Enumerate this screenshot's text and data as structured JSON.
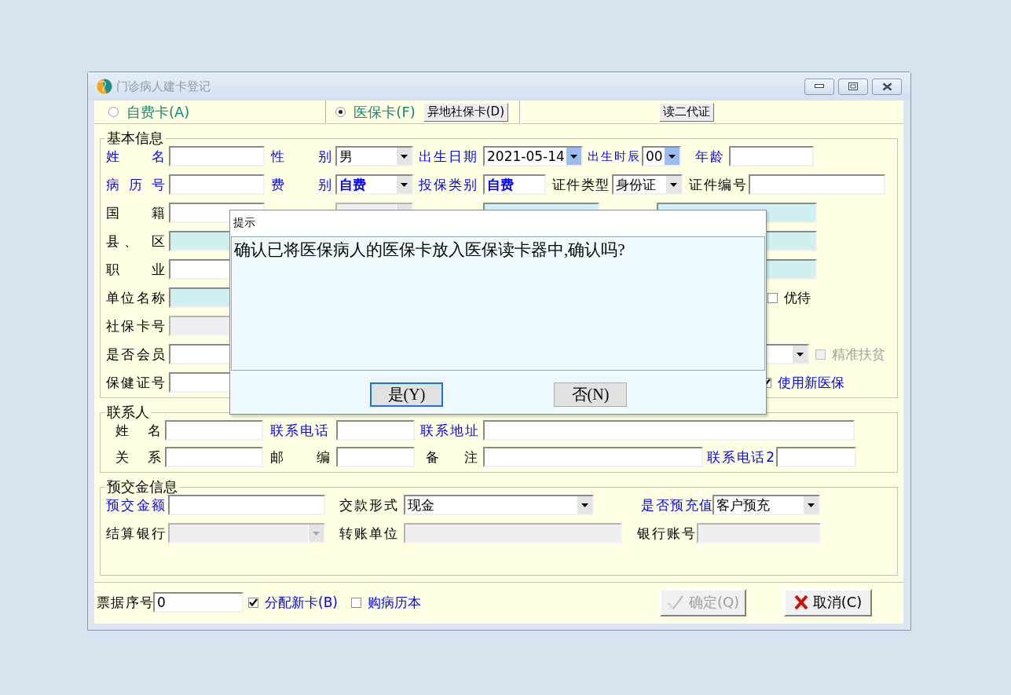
{
  "window": {
    "title": "门诊病人建卡登记"
  },
  "card_type": {
    "options": [
      {
        "label": "自费卡(A)",
        "selected": false
      },
      {
        "label": "医保卡(F)",
        "selected": true
      }
    ],
    "other_region_button": "异地社保卡(D)",
    "read_id_button": "读二代证"
  },
  "basic_info": {
    "title": "基本信息",
    "rows": [
      {
        "items": [
          {
            "kind": "label",
            "text": "姓 名",
            "required": true
          },
          {
            "kind": "field",
            "highlighted": false,
            "disabled": false
          },
          {
            "kind": "label",
            "text": "性 别",
            "required": true
          },
          {
            "kind": "select",
            "value": "男",
            "highlighted": false,
            "disabled": false
          },
          {
            "kind": "label",
            "text": "出生日期",
            "required": true
          },
          {
            "kind": "select",
            "value": "2021-05-14",
            "highlighted": true,
            "disabled": false
          },
          {
            "kind": "label",
            "text": "出生时辰",
            "required": true
          },
          {
            "kind": "select",
            "value": "00",
            "highlighted": true,
            "disabled": false
          },
          {
            "kind": "label",
            "text": "年龄",
            "required": true
          },
          {
            "kind": "field",
            "highlighted": false,
            "disabled": false
          }
        ]
      },
      {
        "items": [
          {
            "kind": "label",
            "text": "病 历 号",
            "required": true
          },
          {
            "kind": "field",
            "highlighted": false,
            "disabled": false
          },
          {
            "kind": "label",
            "text": "费 别",
            "required": true
          },
          {
            "kind": "select",
            "value": "自费",
            "emphasis": true,
            "highlighted": false,
            "disabled": false
          },
          {
            "kind": "label",
            "text": "投保类别",
            "required": true
          },
          {
            "kind": "field",
            "value": "自费",
            "emphasis": true,
            "highlighted": false,
            "disabled": false
          },
          {
            "kind": "label",
            "text": "证件类型",
            "required": false
          },
          {
            "kind": "select",
            "value": "身份证",
            "highlighted": false,
            "disabled": false
          },
          {
            "kind": "label",
            "text": "证件编号",
            "required": false
          },
          {
            "kind": "field",
            "highlighted": false,
            "disabled": false
          }
        ]
      },
      {
        "items": [
          {
            "kind": "label",
            "text": "国 籍",
            "required": false
          },
          {
            "kind": "field",
            "highlighted": false,
            "disabled": false
          },
          {
            "kind": "select",
            "highlighted": false,
            "disabled": true
          },
          {
            "kind": "field",
            "highlighted": true,
            "disabled": false
          },
          {
            "kind": "field",
            "highlighted": true,
            "disabled": false
          }
        ]
      },
      {
        "items": [
          {
            "kind": "label",
            "text": "县、 区",
            "required": false
          },
          {
            "kind": "field",
            "highlighted": true,
            "disabled": false
          },
          {
            "kind": "field",
            "highlighted": true,
            "disabled": false
          }
        ]
      },
      {
        "items": [
          {
            "kind": "label",
            "text": "职 业",
            "required": false
          },
          {
            "kind": "field",
            "highlighted": false,
            "disabled": false
          },
          {
            "kind": "field",
            "highlighted": true,
            "disabled": false
          }
        ]
      },
      {
        "items": [
          {
            "kind": "label",
            "text": "单位名称",
            "required": false
          },
          {
            "kind": "field",
            "highlighted": true,
            "disabled": false
          },
          {
            "kind": "check",
            "label": "优待",
            "checked": false,
            "disabled": false,
            "required": false
          }
        ]
      },
      {
        "items": [
          {
            "kind": "label",
            "text": "社保卡号",
            "required": false
          },
          {
            "kind": "field",
            "highlighted": false,
            "disabled": true
          }
        ]
      },
      {
        "items": [
          {
            "kind": "label",
            "text": "是否会员",
            "required": false
          },
          {
            "kind": "field",
            "highlighted": false,
            "disabled": false
          },
          {
            "kind": "select",
            "highlighted": false,
            "disabled": false
          },
          {
            "kind": "check",
            "label": "精准扶贫",
            "checked": false,
            "disabled": true,
            "required": false
          }
        ]
      },
      {
        "items": [
          {
            "kind": "label",
            "text": "保健证号",
            "required": false
          },
          {
            "kind": "field",
            "highlighted": false,
            "disabled": false
          },
          {
            "kind": "check",
            "label": "使用新医保",
            "checked": true,
            "disabled": false,
            "required": true
          }
        ]
      }
    ]
  },
  "contact": {
    "title": "联系人",
    "rows": [
      {
        "items": [
          {
            "kind": "label",
            "text": "姓 名",
            "required": false
          },
          {
            "kind": "field",
            "highlighted": false,
            "disabled": false
          },
          {
            "kind": "label",
            "text": "联系电话",
            "required": true
          },
          {
            "kind": "field",
            "highlighted": false,
            "disabled": false
          },
          {
            "kind": "label",
            "text": "联系地址",
            "required": true
          },
          {
            "kind": "field",
            "highlighted": false,
            "disabled": false
          }
        ]
      },
      {
        "items": [
          {
            "kind": "label",
            "text": "关 系",
            "required": false
          },
          {
            "kind": "field",
            "highlighted": false,
            "disabled": false
          },
          {
            "kind": "label",
            "text": "邮 编",
            "required": false
          },
          {
            "kind": "field",
            "highlighted": false,
            "disabled": false
          },
          {
            "kind": "label",
            "text": "备 注",
            "required": false
          },
          {
            "kind": "field",
            "highlighted": false,
            "disabled": false
          },
          {
            "kind": "label",
            "text": "联系电话2",
            "required": true
          },
          {
            "kind": "field",
            "highlighted": false,
            "disabled": false
          }
        ]
      }
    ]
  },
  "prepayment": {
    "title": "预交金信息",
    "rows": [
      {
        "items": [
          {
            "kind": "label",
            "text": "预交金额",
            "required": true
          },
          {
            "kind": "field",
            "highlighted": false,
            "disabled": false
          },
          {
            "kind": "label",
            "text": "交款形式",
            "required": false
          },
          {
            "kind": "select",
            "value": "现金",
            "highlighted": false,
            "disabled": false
          },
          {
            "kind": "label",
            "text": "是否预充值",
            "required": true
          },
          {
            "kind": "select",
            "value": "客户预充",
            "highlighted": false,
            "disabled": false
          }
        ]
      },
      {
        "items": [
          {
            "kind": "label",
            "text": "结算银行",
            "required": false
          },
          {
            "kind": "select",
            "highlighted": false,
            "disabled": true
          },
          {
            "kind": "label",
            "text": "转账单位",
            "required": false
          },
          {
            "kind": "field",
            "highlighted": false,
            "disabled": true
          },
          {
            "kind": "label",
            "text": "银行账号",
            "required": false
          },
          {
            "kind": "field",
            "highlighted": false,
            "disabled": true
          }
        ]
      }
    ]
  },
  "footer": {
    "items": [
      {
        "kind": "label",
        "text": "票据序号",
        "required": false
      },
      {
        "kind": "field",
        "value": "0",
        "highlighted": false,
        "disabled": false
      },
      {
        "kind": "check",
        "label": "分配新卡(B)",
        "checked": true,
        "disabled": false,
        "required": true
      },
      {
        "kind": "check",
        "label": "购病历本",
        "checked": false,
        "disabled": false,
        "required": true
      },
      {
        "kind": "confirm",
        "label": "确定(Q)",
        "disabled": true
      },
      {
        "kind": "cancel",
        "label": "取消(C)",
        "disabled": false
      }
    ]
  },
  "dialog": {
    "title": "提示",
    "message": "确认已将医保病人的医保卡放入医保读卡器中,确认吗?",
    "buttons": [
      {
        "label": "是(Y)",
        "focused": true
      },
      {
        "label": "否(N)",
        "focused": false
      }
    ]
  }
}
